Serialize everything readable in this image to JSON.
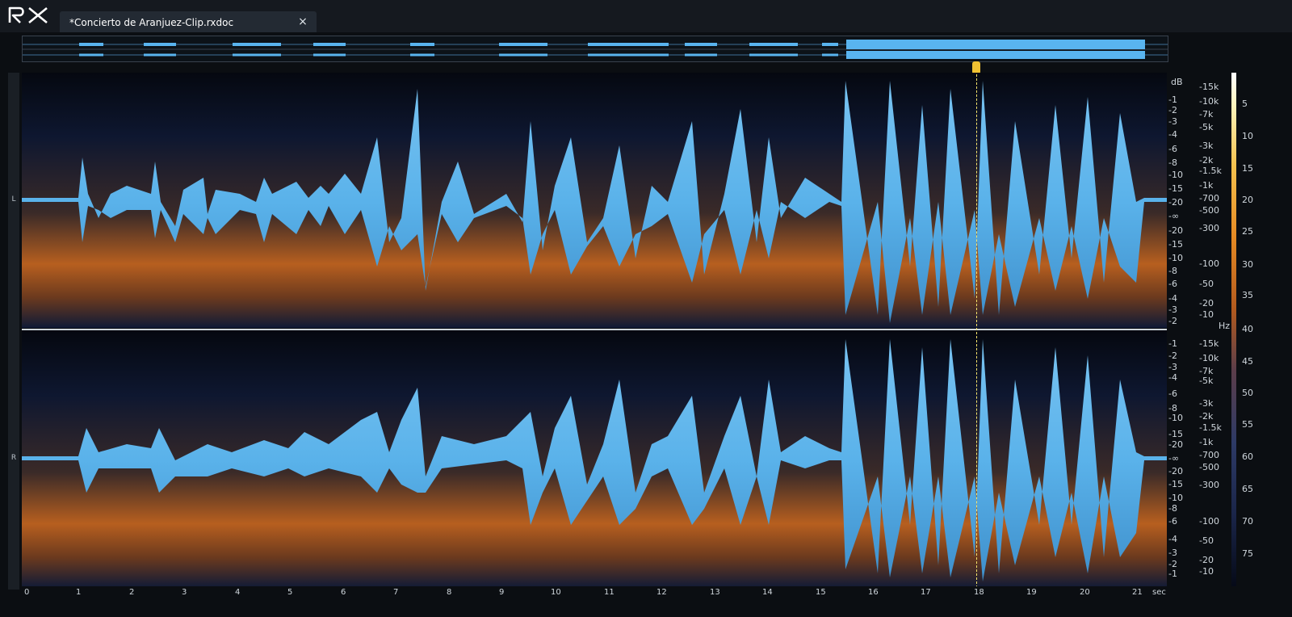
{
  "app": {
    "logo": "RX"
  },
  "tab": {
    "title": "*Concierto de Aranjuez-Clip.rxdoc",
    "close_glyph": "×"
  },
  "channels": {
    "left": "L",
    "right": "R"
  },
  "amplitude_axis": {
    "unit": "dB",
    "labels": [
      "-1",
      "-2",
      "-3",
      "-4",
      "-6",
      "-8",
      "-10",
      "-15",
      "-20",
      "-∞",
      "-20",
      "-15",
      "-10",
      "-8",
      "-6",
      "-4",
      "-3",
      "-2",
      "-1"
    ]
  },
  "frequency_axis": {
    "unit": "Hz",
    "labels": [
      "-15k",
      "-10k",
      "-7k",
      "-5k",
      "-3k",
      "-2k",
      "-1.5k",
      "-1k",
      "-700",
      "-500",
      "-300",
      "-100",
      "-50",
      "-20",
      "-10"
    ]
  },
  "db_scale": {
    "labels": [
      "5",
      "10",
      "15",
      "20",
      "25",
      "30",
      "35",
      "40",
      "45",
      "50",
      "55",
      "60",
      "65",
      "70",
      "75"
    ]
  },
  "time_axis": {
    "unit": "sec",
    "labels": [
      "0",
      "1",
      "2",
      "3",
      "4",
      "5",
      "6",
      "7",
      "8",
      "9",
      "10",
      "11",
      "12",
      "13",
      "14",
      "15",
      "16",
      "17",
      "18",
      "19",
      "20",
      "21"
    ]
  },
  "playhead": {
    "time_sec": 17.9
  }
}
